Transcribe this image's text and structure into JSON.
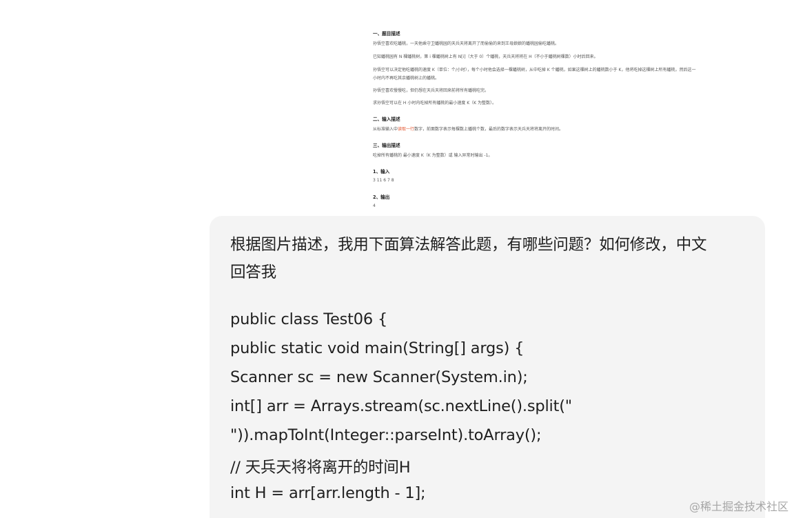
{
  "problem_image": {
    "section1_title": "一、题目描述",
    "p1": "孙悟空喜欢吃蟠桃，一天他乘守卫蟠桃园的天兵天将离开了而偷偷的来到王母娘娘的蟠桃园偷吃蟠桃。",
    "p2": "已知蟠桃园有 N 棵蟠桃树，第 i 棵蟠桃树上有 N[i]（大于 0）个蟠桃，天兵天将将在 H（不小于蟠桃树棵数）小时后回来。",
    "p3a": "孙悟空可以决定他吃蟠桃的速度 K（单位：个/小时），每个小时他会选择一棵蟠桃树，从中吃掉 K 个蟠桃，如果这棵树上的蟠桃数小于 K，他将吃掉这棵树上所有蟠桃，然后这一",
    "p3b": "小时内不再吃其余蟠桃树上的蟠桃。",
    "p4": "孙悟空喜欢慢慢吃，但仍想在天兵天将回来前将所有蟠桃吃完。",
    "p5": "求孙悟空可以在 H 小时内吃掉所有蟠桃的最小速度 K（K 为整数）。",
    "section2_title": "二、输入描述",
    "p6_before": "从标准输入中",
    "p6_highlight": "读取一行",
    "p6_after": "数字，前面数字表示每棵数上蟠桃个数，最后的数字表示天兵天将将离开的时间。",
    "section3_title": "三、输出描述",
    "p7": "吃掉所有蟠桃的 最小速度 K（K 为整数）或 输入异常时输出 -1。",
    "input_title": "1、输入",
    "input_value": "3 11 6 7 8",
    "output_title": "2、输出",
    "output_value": "4"
  },
  "message": {
    "lines": [
      "根据图片描述，我用下面算法解答此题，有哪些问题？如何修改，中文",
      "回答我",
      "public class Test06 {",
      "public static void main(String[] args) {",
      "Scanner sc = new Scanner(System.in);",
      "int[] arr = Arrays.stream(sc.nextLine().split(\"",
      "\")).mapToInt(Integer::parseInt).toArray();",
      "// 天兵天将将离开的时间H",
      "int H = arr[arr.length - 1];"
    ]
  },
  "watermark": "@稀土掘金技术社区"
}
